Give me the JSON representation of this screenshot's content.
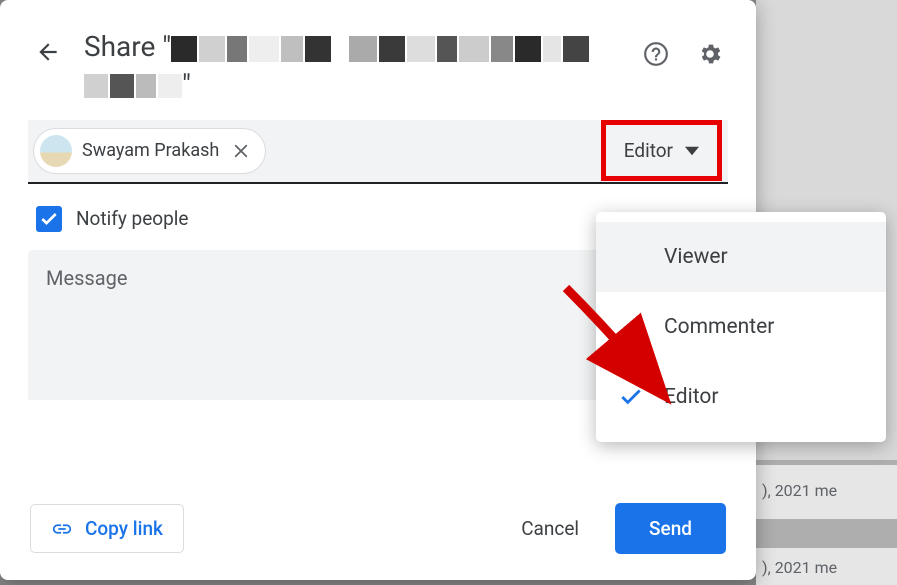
{
  "dialog": {
    "title_prefix": "Share \"",
    "title_suffix": "\"",
    "chip_name": "Swayam Prakash",
    "role_selected": "Editor",
    "notify_label": "Notify people",
    "notify_checked": true,
    "message_placeholder": "Message",
    "copy_link_label": "Copy link",
    "cancel_label": "Cancel",
    "send_label": "Send"
  },
  "menu": {
    "items": [
      {
        "label": "Viewer",
        "selected": false
      },
      {
        "label": "Commenter",
        "selected": false
      },
      {
        "label": "Editor",
        "selected": true
      }
    ]
  },
  "background": {
    "row1": "), 2021 me",
    "row2": "), 2021 me"
  }
}
